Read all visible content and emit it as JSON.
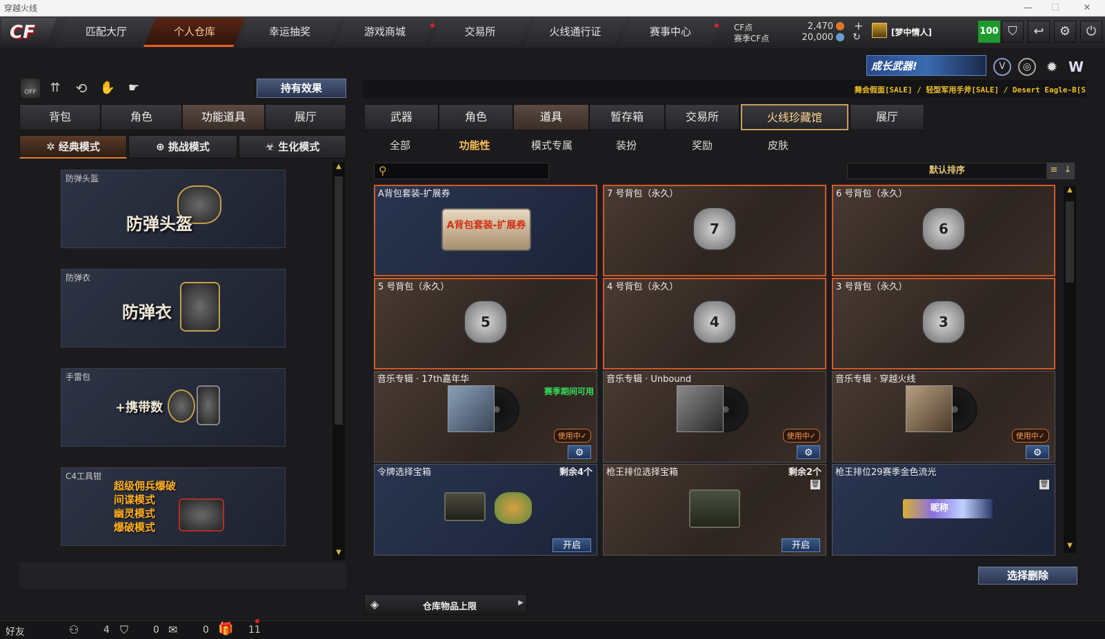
{
  "window": {
    "title": "穿越火线",
    "min": "—",
    "max": "☐",
    "close": "✕"
  },
  "logo": "CF",
  "nav": [
    {
      "label": "匹配大厅",
      "dot": false
    },
    {
      "label": "个人仓库",
      "dot": false,
      "active": true
    },
    {
      "label": "幸运抽奖",
      "dot": false
    },
    {
      "label": "游戏商城",
      "dot": true
    },
    {
      "label": "交易所",
      "dot": false
    },
    {
      "label": "火线通行证",
      "dot": false
    },
    {
      "label": "赛事中心",
      "dot": true
    }
  ],
  "currency": {
    "cf_label": "CF点",
    "cf_value": "2,470",
    "season_label": "赛季CF点",
    "season_value": "20,000",
    "plus": "+",
    "refresh": "↻"
  },
  "player": {
    "name": "[梦中情人]",
    "level": "100"
  },
  "top_icons": [
    "shield-icon",
    "return-icon",
    "gear-icon",
    "power-icon"
  ],
  "banner": {
    "text": "成长武器!",
    "icons": [
      "badge-v-icon",
      "globe-icon",
      "gear-badge-icon",
      "w-logo-icon"
    ]
  },
  "ticker": "舞会假面[SALE] / 轻型军用手斧[SALE] / Desert Eagle-B[S",
  "left": {
    "toolbar": [
      {
        "name": "off-toggle-icon",
        "label": "OFF"
      },
      {
        "name": "stats-icon",
        "label": "⇈"
      },
      {
        "name": "history-icon",
        "label": "⟲"
      },
      {
        "name": "hand-icon",
        "label": "✋"
      },
      {
        "name": "glove-icon",
        "label": "☛"
      }
    ],
    "effect_button": "持有效果",
    "tabs": [
      "背包",
      "角色",
      "功能道具",
      "展厅"
    ],
    "active_tab": 2,
    "modes": [
      {
        "label": "经典模式",
        "icon": "✲"
      },
      {
        "label": "挑战模式",
        "icon": "⊕"
      },
      {
        "label": "生化模式",
        "icon": "☣"
      }
    ],
    "cards": [
      {
        "title": "防弹头盔",
        "big": "防弹头盔",
        "lines": []
      },
      {
        "title": "防弹衣",
        "big": "防弹衣",
        "lines": []
      },
      {
        "title": "手雷包",
        "big": "+携带数",
        "lines": []
      },
      {
        "title": "C4工具钳",
        "big": "",
        "lines": [
          "超级佣兵爆破",
          "间谍模式",
          "幽灵模式",
          "爆破模式"
        ]
      }
    ]
  },
  "right": {
    "tabs": [
      "武器",
      "角色",
      "道具",
      "暂存箱",
      "交易所",
      "火线珍藏馆",
      "展厅"
    ],
    "active_tab": 2,
    "subtabs": [
      "全部",
      "功能性",
      "模式专属",
      "装扮",
      "奖励",
      "皮肤"
    ],
    "active_subtab": 1,
    "search_placeholder": "",
    "sort_label": "默认排序",
    "items": [
      {
        "name": "A背包套装-扩展券",
        "style": "blue",
        "sel": true,
        "icon": "A背包套装-扩展券"
      },
      {
        "name": "7 号背包（永久）",
        "style": "brown",
        "sel": true,
        "icon": "7"
      },
      {
        "name": "6 号背包（永久）",
        "style": "brown",
        "sel": true,
        "icon": "6"
      },
      {
        "name": "5 号背包（永久）",
        "style": "brown",
        "sel": true,
        "icon": "5"
      },
      {
        "name": "4 号背包（永久）",
        "style": "brown",
        "sel": true,
        "icon": "4"
      },
      {
        "name": "3 号背包（永久）",
        "style": "brown",
        "sel": true,
        "icon": "3"
      },
      {
        "name": "音乐专辑 · 17th嘉年华",
        "style": "brown",
        "sel": false,
        "season": "赛季期间可用",
        "badge": "使用中✓",
        "gear": "⚙"
      },
      {
        "name": "音乐专辑 · Unbound",
        "style": "brown",
        "sel": false,
        "badge": "使用中✓",
        "gear": "⚙"
      },
      {
        "name": "音乐专辑 · 穿越火线",
        "style": "brown",
        "sel": false,
        "badge": "使用中✓",
        "gear": "⚙"
      },
      {
        "name": "令牌选择宝箱",
        "style": "blue",
        "sel": false,
        "count": "剩余4个",
        "open": "开启"
      },
      {
        "name": "枪王排位选择宝箱",
        "style": "brown",
        "sel": false,
        "count": "剩余2个",
        "open": "开启",
        "trash": "🗑"
      },
      {
        "name": "枪王排位29赛季金色流光",
        "style": "blue",
        "sel": false,
        "trash": "🗑",
        "tag": "昵称"
      }
    ],
    "delete_button": "选择删除",
    "storage_label": "仓库物品上限"
  },
  "status": {
    "left": "好友",
    "friends": "4",
    "guild": "0",
    "chat": "0",
    "gift": "11"
  }
}
